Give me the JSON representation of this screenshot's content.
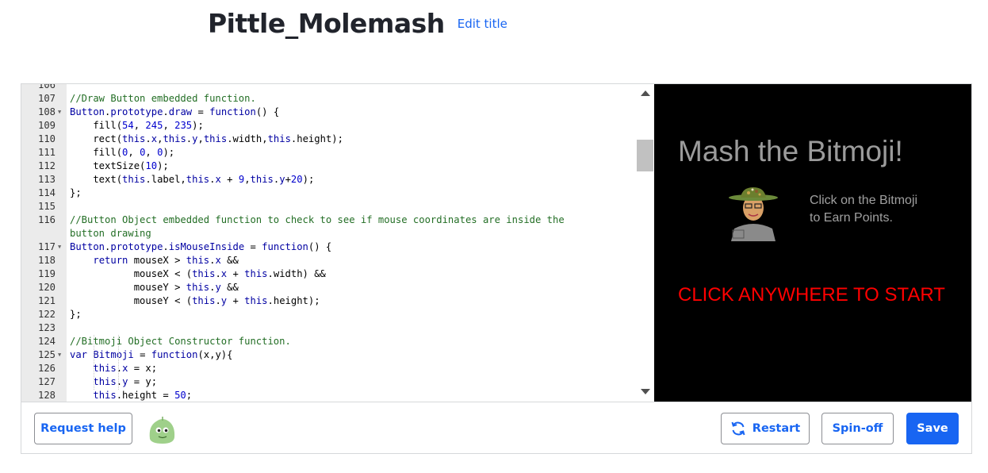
{
  "header": {
    "title": "Pittle_Molemash",
    "edit_title_label": "Edit title"
  },
  "editor": {
    "lines": [
      {
        "num": "106",
        "fold": false,
        "tokens": []
      },
      {
        "num": "107",
        "fold": false,
        "tokens": [
          {
            "t": "//Draw Button embedded function.",
            "c": "c-comment"
          }
        ]
      },
      {
        "num": "108",
        "fold": true,
        "tokens": [
          {
            "t": "Button",
            "c": "c-kw"
          },
          {
            "t": ".",
            "c": ""
          },
          {
            "t": "prototype",
            "c": "c-kw"
          },
          {
            "t": ".",
            "c": ""
          },
          {
            "t": "draw",
            "c": "c-kw"
          },
          {
            "t": " = ",
            "c": ""
          },
          {
            "t": "function",
            "c": "c-kw"
          },
          {
            "t": "() {",
            "c": ""
          }
        ]
      },
      {
        "num": "109",
        "fold": false,
        "tokens": [
          {
            "t": "    fill(",
            "c": ""
          },
          {
            "t": "54",
            "c": "c-num"
          },
          {
            "t": ", ",
            "c": ""
          },
          {
            "t": "245",
            "c": "c-num"
          },
          {
            "t": ", ",
            "c": ""
          },
          {
            "t": "235",
            "c": "c-num"
          },
          {
            "t": ");",
            "c": ""
          }
        ]
      },
      {
        "num": "110",
        "fold": false,
        "tokens": [
          {
            "t": "    rect(",
            "c": ""
          },
          {
            "t": "this",
            "c": "c-kw"
          },
          {
            "t": ".",
            "c": ""
          },
          {
            "t": "x",
            "c": "c-kw"
          },
          {
            "t": ",",
            "c": ""
          },
          {
            "t": "this",
            "c": "c-kw"
          },
          {
            "t": ".",
            "c": ""
          },
          {
            "t": "y",
            "c": "c-kw"
          },
          {
            "t": ",",
            "c": ""
          },
          {
            "t": "this",
            "c": "c-kw"
          },
          {
            "t": ".width,",
            "c": ""
          },
          {
            "t": "this",
            "c": "c-kw"
          },
          {
            "t": ".height);",
            "c": ""
          }
        ]
      },
      {
        "num": "111",
        "fold": false,
        "tokens": [
          {
            "t": "    fill(",
            "c": ""
          },
          {
            "t": "0",
            "c": "c-num"
          },
          {
            "t": ", ",
            "c": ""
          },
          {
            "t": "0",
            "c": "c-num"
          },
          {
            "t": ", ",
            "c": ""
          },
          {
            "t": "0",
            "c": "c-num"
          },
          {
            "t": ");",
            "c": ""
          }
        ]
      },
      {
        "num": "112",
        "fold": false,
        "tokens": [
          {
            "t": "    textSize(",
            "c": ""
          },
          {
            "t": "10",
            "c": "c-num"
          },
          {
            "t": ");",
            "c": ""
          }
        ]
      },
      {
        "num": "113",
        "fold": false,
        "tokens": [
          {
            "t": "    text(",
            "c": ""
          },
          {
            "t": "this",
            "c": "c-kw"
          },
          {
            "t": ".label,",
            "c": ""
          },
          {
            "t": "this",
            "c": "c-kw"
          },
          {
            "t": ".",
            "c": ""
          },
          {
            "t": "x",
            "c": "c-kw"
          },
          {
            "t": " + ",
            "c": ""
          },
          {
            "t": "9",
            "c": "c-num"
          },
          {
            "t": ",",
            "c": ""
          },
          {
            "t": "this",
            "c": "c-kw"
          },
          {
            "t": ".",
            "c": ""
          },
          {
            "t": "y",
            "c": "c-kw"
          },
          {
            "t": "+",
            "c": ""
          },
          {
            "t": "20",
            "c": "c-num"
          },
          {
            "t": ");",
            "c": ""
          }
        ]
      },
      {
        "num": "114",
        "fold": false,
        "tokens": [
          {
            "t": "};",
            "c": ""
          }
        ]
      },
      {
        "num": "115",
        "fold": false,
        "tokens": []
      },
      {
        "num": "116",
        "fold": false,
        "tokens": [
          {
            "t": "//Button Object embedded function to check to see if mouse coordinates are inside the",
            "c": "c-comment"
          }
        ]
      },
      {
        "num": "",
        "fold": false,
        "tokens": [
          {
            "t": "button drawing",
            "c": "c-comment"
          }
        ]
      },
      {
        "num": "117",
        "fold": true,
        "tokens": [
          {
            "t": "Button",
            "c": "c-kw"
          },
          {
            "t": ".",
            "c": ""
          },
          {
            "t": "prototype",
            "c": "c-kw"
          },
          {
            "t": ".",
            "c": ""
          },
          {
            "t": "isMouseInside",
            "c": "c-kw"
          },
          {
            "t": " = ",
            "c": ""
          },
          {
            "t": "function",
            "c": "c-kw"
          },
          {
            "t": "() {",
            "c": ""
          }
        ]
      },
      {
        "num": "118",
        "fold": false,
        "tokens": [
          {
            "t": "    ",
            "c": ""
          },
          {
            "t": "return",
            "c": "c-kw"
          },
          {
            "t": " mouseX > ",
            "c": ""
          },
          {
            "t": "this",
            "c": "c-kw"
          },
          {
            "t": ".",
            "c": ""
          },
          {
            "t": "x",
            "c": "c-kw"
          },
          {
            "t": " &&",
            "c": ""
          }
        ]
      },
      {
        "num": "119",
        "fold": false,
        "tokens": [
          {
            "t": "           mouseX < (",
            "c": ""
          },
          {
            "t": "this",
            "c": "c-kw"
          },
          {
            "t": ".",
            "c": ""
          },
          {
            "t": "x",
            "c": "c-kw"
          },
          {
            "t": " + ",
            "c": ""
          },
          {
            "t": "this",
            "c": "c-kw"
          },
          {
            "t": ".width) &&",
            "c": ""
          }
        ]
      },
      {
        "num": "120",
        "fold": false,
        "tokens": [
          {
            "t": "           mouseY > ",
            "c": ""
          },
          {
            "t": "this",
            "c": "c-kw"
          },
          {
            "t": ".",
            "c": ""
          },
          {
            "t": "y",
            "c": "c-kw"
          },
          {
            "t": " &&",
            "c": ""
          }
        ]
      },
      {
        "num": "121",
        "fold": false,
        "tokens": [
          {
            "t": "           mouseY < (",
            "c": ""
          },
          {
            "t": "this",
            "c": "c-kw"
          },
          {
            "t": ".",
            "c": ""
          },
          {
            "t": "y",
            "c": "c-kw"
          },
          {
            "t": " + ",
            "c": ""
          },
          {
            "t": "this",
            "c": "c-kw"
          },
          {
            "t": ".height);",
            "c": ""
          }
        ]
      },
      {
        "num": "122",
        "fold": false,
        "tokens": [
          {
            "t": "};",
            "c": ""
          }
        ]
      },
      {
        "num": "123",
        "fold": false,
        "tokens": []
      },
      {
        "num": "124",
        "fold": false,
        "tokens": [
          {
            "t": "//Bitmoji Object Constructor function.",
            "c": "c-comment"
          }
        ]
      },
      {
        "num": "125",
        "fold": true,
        "tokens": [
          {
            "t": "var",
            "c": "c-kw"
          },
          {
            "t": " ",
            "c": ""
          },
          {
            "t": "Bitmoji",
            "c": "c-kw"
          },
          {
            "t": " = ",
            "c": ""
          },
          {
            "t": "function",
            "c": "c-kw"
          },
          {
            "t": "(x,y){",
            "c": ""
          }
        ]
      },
      {
        "num": "126",
        "fold": false,
        "tokens": [
          {
            "t": "    ",
            "c": ""
          },
          {
            "t": "this",
            "c": "c-kw"
          },
          {
            "t": ".",
            "c": ""
          },
          {
            "t": "x",
            "c": "c-kw"
          },
          {
            "t": " = x;",
            "c": ""
          }
        ]
      },
      {
        "num": "127",
        "fold": false,
        "tokens": [
          {
            "t": "    ",
            "c": ""
          },
          {
            "t": "this",
            "c": "c-kw"
          },
          {
            "t": ".",
            "c": ""
          },
          {
            "t": "y",
            "c": "c-kw"
          },
          {
            "t": " = y;",
            "c": ""
          }
        ]
      },
      {
        "num": "128",
        "fold": false,
        "tokens": [
          {
            "t": "    ",
            "c": ""
          },
          {
            "t": "this",
            "c": "c-kw"
          },
          {
            "t": ".height = ",
            "c": ""
          },
          {
            "t": "50",
            "c": "c-num"
          },
          {
            "t": ";",
            "c": ""
          }
        ]
      }
    ]
  },
  "canvas": {
    "game_title": "Mash the Bitmoji!",
    "instructions": "Click on the Bitmoji to Earn Points.",
    "start_text": "CLICK ANYWHERE TO START",
    "background": "#000000",
    "start_color": "#ff0000"
  },
  "footer": {
    "request_help_label": "Request help",
    "avatar_icon": "green-blob-avatar-icon",
    "restart_label": "Restart",
    "spinoff_label": "Spin-off",
    "save_label": "Save",
    "accent_color": "#1865f2"
  }
}
